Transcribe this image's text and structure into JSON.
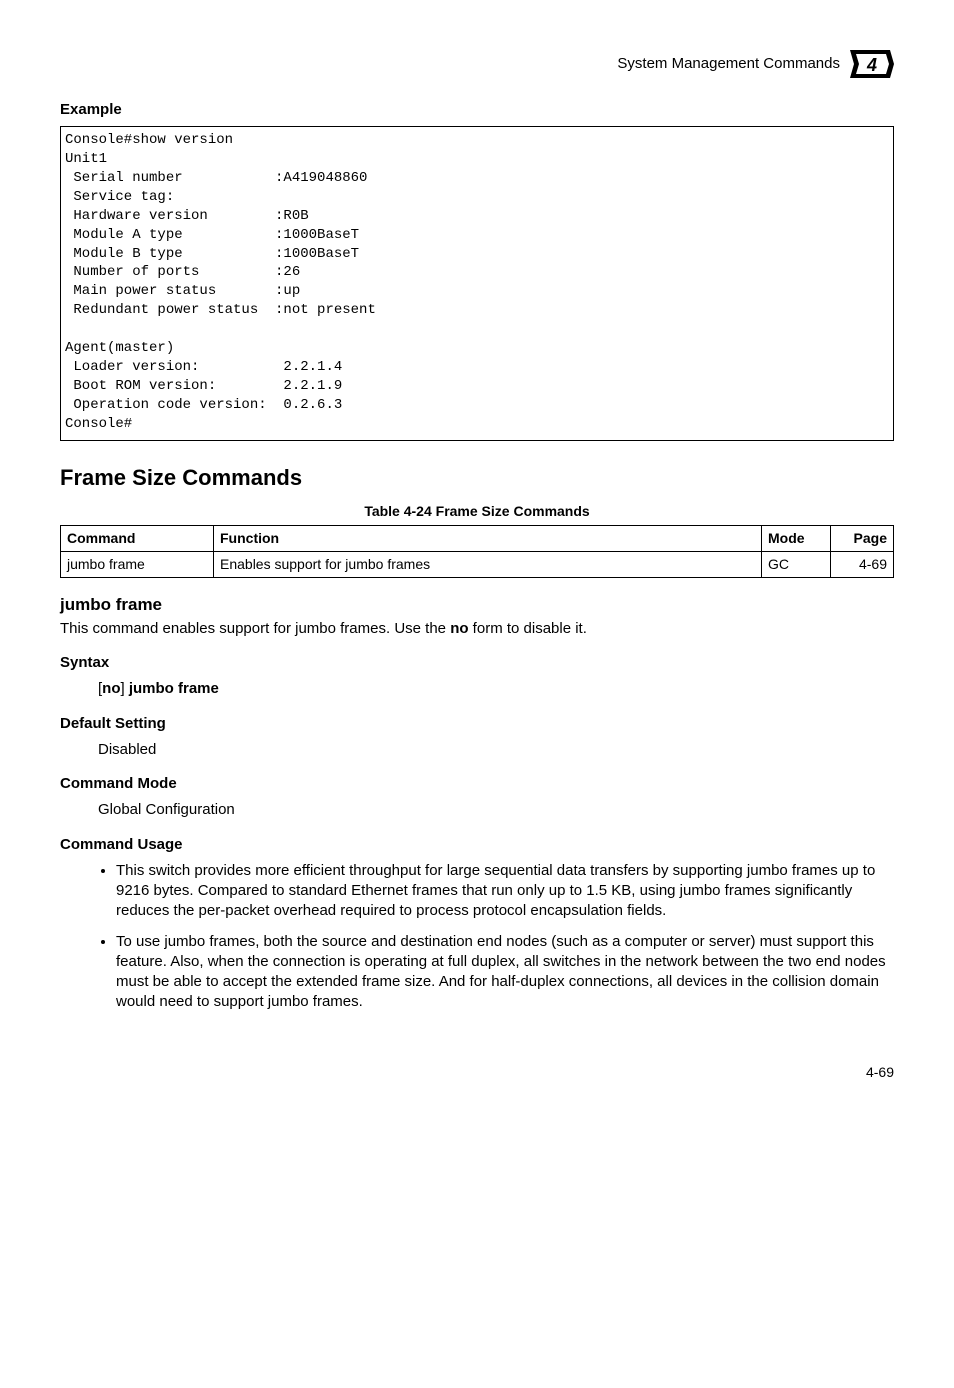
{
  "header": {
    "breadcrumb": "System Management Commands",
    "chapter_number": "4"
  },
  "example": {
    "heading": "Example",
    "console": "Console#show version\nUnit1\n Serial number           :A419048860\n Service tag:\n Hardware version        :R0B\n Module A type           :1000BaseT\n Module B type           :1000BaseT\n Number of ports         :26\n Main power status       :up\n Redundant power status  :not present\n\nAgent(master)\n Loader version:          2.2.1.4\n Boot ROM version:        2.2.1.9\n Operation code version:  0.2.6.3\nConsole#"
  },
  "section": {
    "title": "Frame Size Commands",
    "table_caption": "Table 4-24  Frame Size Commands",
    "table": {
      "headers": {
        "command": "Command",
        "function": "Function",
        "mode": "Mode",
        "page": "Page"
      },
      "rows": [
        {
          "command": "jumbo frame",
          "function": "Enables support for jumbo frames",
          "mode": "GC",
          "page": "4-69"
        }
      ]
    }
  },
  "command": {
    "name": "jumbo frame",
    "description_prefix": "This command enables support for jumbo frames. Use the ",
    "description_bold": "no",
    "description_suffix": " form to disable it.",
    "syntax_heading": "Syntax",
    "syntax_open": "[",
    "syntax_no": "no",
    "syntax_mid": "] ",
    "syntax_cmd": "jumbo frame",
    "default_heading": "Default Setting",
    "default_value": "Disabled",
    "mode_heading": "Command Mode",
    "mode_value": "Global Configuration",
    "usage_heading": "Command Usage",
    "usage": [
      "This switch provides more efficient throughput for large sequential data transfers by supporting jumbo frames up to 9216 bytes. Compared to standard Ethernet frames that run only up to 1.5 KB, using jumbo frames significantly reduces the per-packet overhead required to process protocol encapsulation fields.",
      "To use jumbo frames, both the source and destination end nodes (such as a computer or server) must support this feature. Also, when the connection is operating at full duplex, all switches in the network between the two end nodes must be able to accept the extended frame size. And for half-duplex connections, all devices in the collision domain would need to support jumbo frames."
    ]
  },
  "footer": {
    "page": "4-69"
  }
}
